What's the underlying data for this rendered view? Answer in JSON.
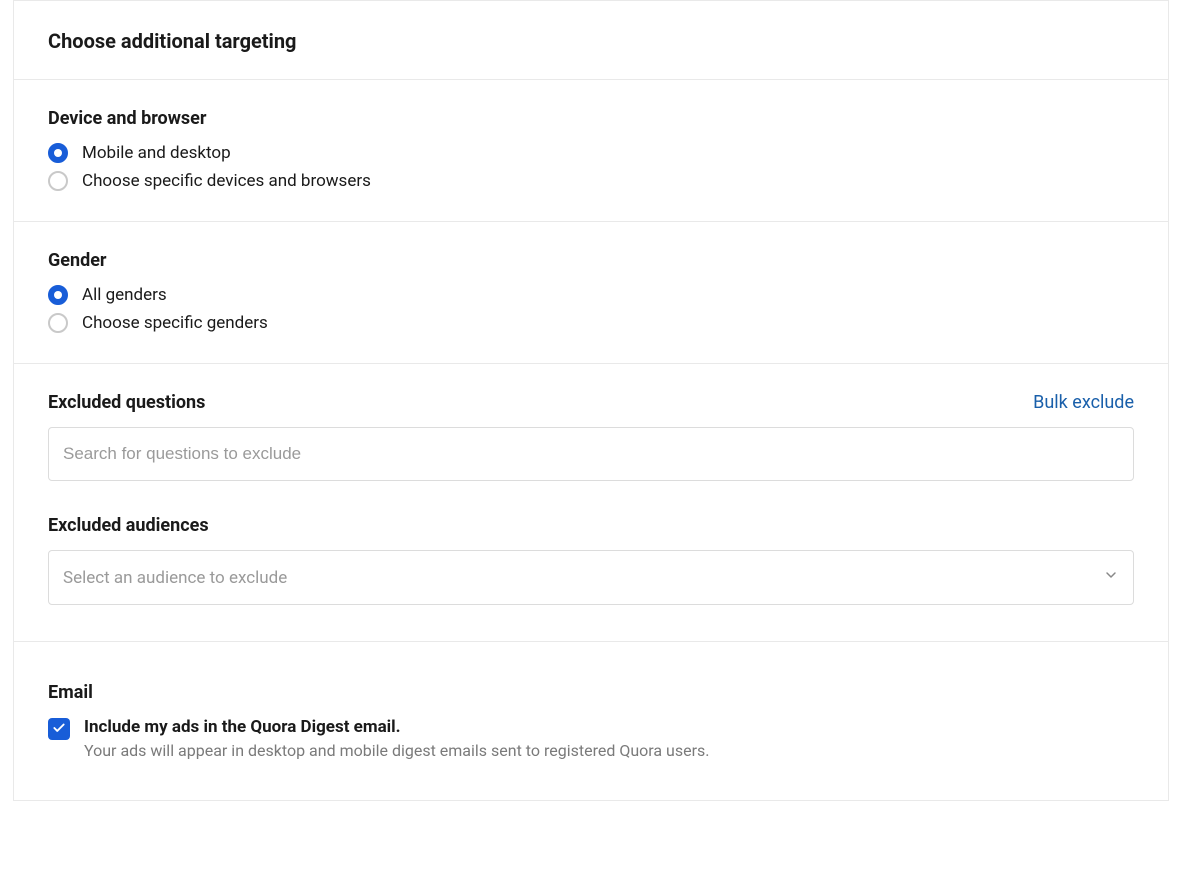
{
  "header": {
    "title": "Choose additional targeting"
  },
  "device": {
    "heading": "Device and browser",
    "options": [
      {
        "label": "Mobile and desktop",
        "selected": true
      },
      {
        "label": "Choose specific devices and browsers",
        "selected": false
      }
    ]
  },
  "gender": {
    "heading": "Gender",
    "options": [
      {
        "label": "All genders",
        "selected": true
      },
      {
        "label": "Choose specific genders",
        "selected": false
      }
    ]
  },
  "excludedQuestions": {
    "heading": "Excluded questions",
    "bulkLink": "Bulk exclude",
    "placeholder": "Search for questions to exclude"
  },
  "excludedAudiences": {
    "heading": "Excluded audiences",
    "placeholder": "Select an audience to exclude"
  },
  "email": {
    "heading": "Email",
    "checkbox": {
      "checked": true,
      "title": "Include my ads in the Quora Digest email.",
      "description": "Your ads will appear in desktop and mobile digest emails sent to registered Quora users."
    }
  }
}
